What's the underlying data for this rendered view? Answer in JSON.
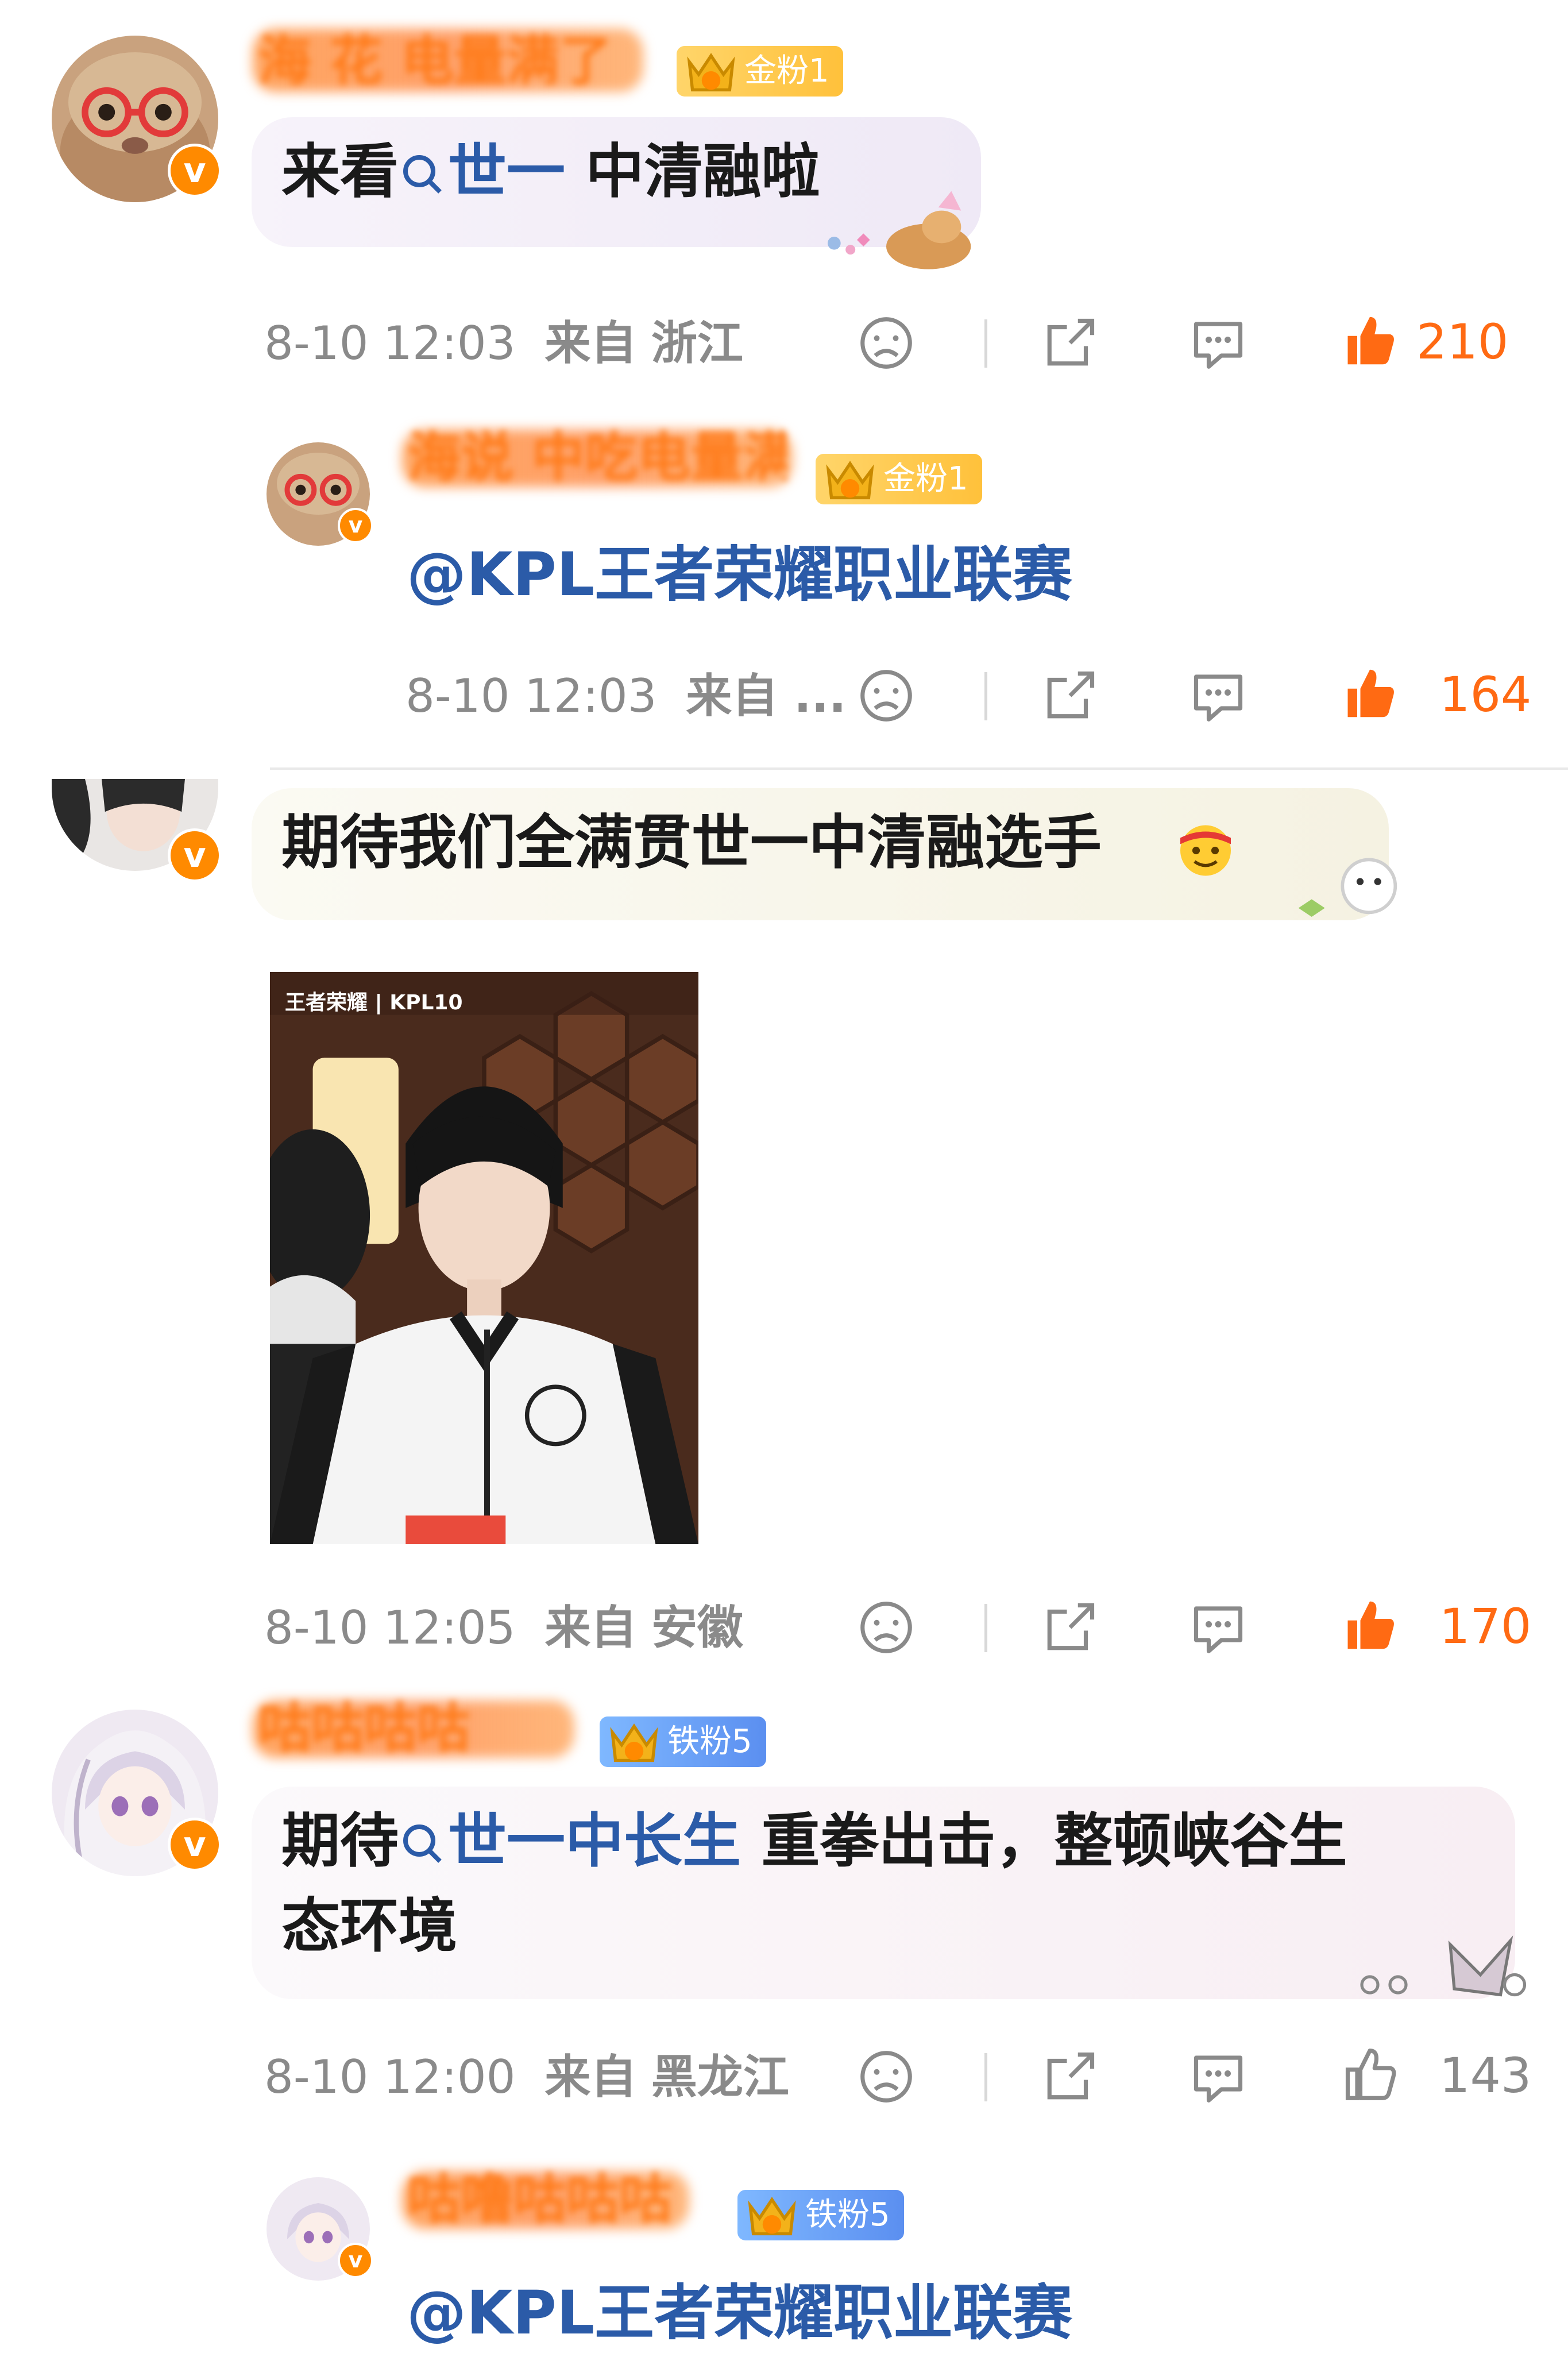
{
  "comments": [
    {
      "name": "海 花 电量满了",
      "badge": {
        "label": "金粉1",
        "level": "4",
        "tier": "gold"
      },
      "text_prefix": "来看",
      "keyword": "世一",
      "text_suffix": " 中清融啦",
      "time": "8-10 12:03",
      "from_label": "来自",
      "location": "浙江",
      "likes": "210",
      "liked": true,
      "reply": {
        "name": "海说 中吃电量满了",
        "badge": {
          "label": "金粉1",
          "level": "4",
          "tier": "gold"
        },
        "text": "@KPL王者荣耀职业联赛",
        "time": "8-10 12:03",
        "from_label": "来自 ...",
        "likes": "164",
        "liked": true
      }
    },
    {
      "name": "",
      "text": "期待我们全满贯世一中清融选手",
      "photo_logo": "王者荣耀 | KPL10",
      "time": "8-10 12:05",
      "from_label": "来自",
      "location": "安徽",
      "likes": "170",
      "liked": true
    },
    {
      "name": "咕咕咕咕",
      "badge": {
        "label": "铁粉5",
        "level": "6",
        "tier": "iron"
      },
      "text_prefix": "期待",
      "keyword": "世一中长生",
      "text_suffix": " 重拳出击，整顿峡谷生",
      "text_line2": "态环境",
      "time": "8-10 12:00",
      "from_label": "来自",
      "location": "黑龙江",
      "likes": "143",
      "liked": false,
      "reply": {
        "name": "咕噜咕咕咕",
        "badge": {
          "label": "铁粉5",
          "level": "6",
          "tier": "iron"
        },
        "text": "@KPL王者荣耀职业联赛"
      }
    }
  ],
  "colors": {
    "accent_orange": "#ff7b1a",
    "keyword_blue": "#2b5ba8",
    "meta_gray": "#8a8a8a",
    "like_orange": "#ff6a13"
  },
  "icons": [
    "search-icon",
    "dislike-icon",
    "share-icon",
    "comment-icon",
    "like-icon",
    "verified-icon"
  ]
}
